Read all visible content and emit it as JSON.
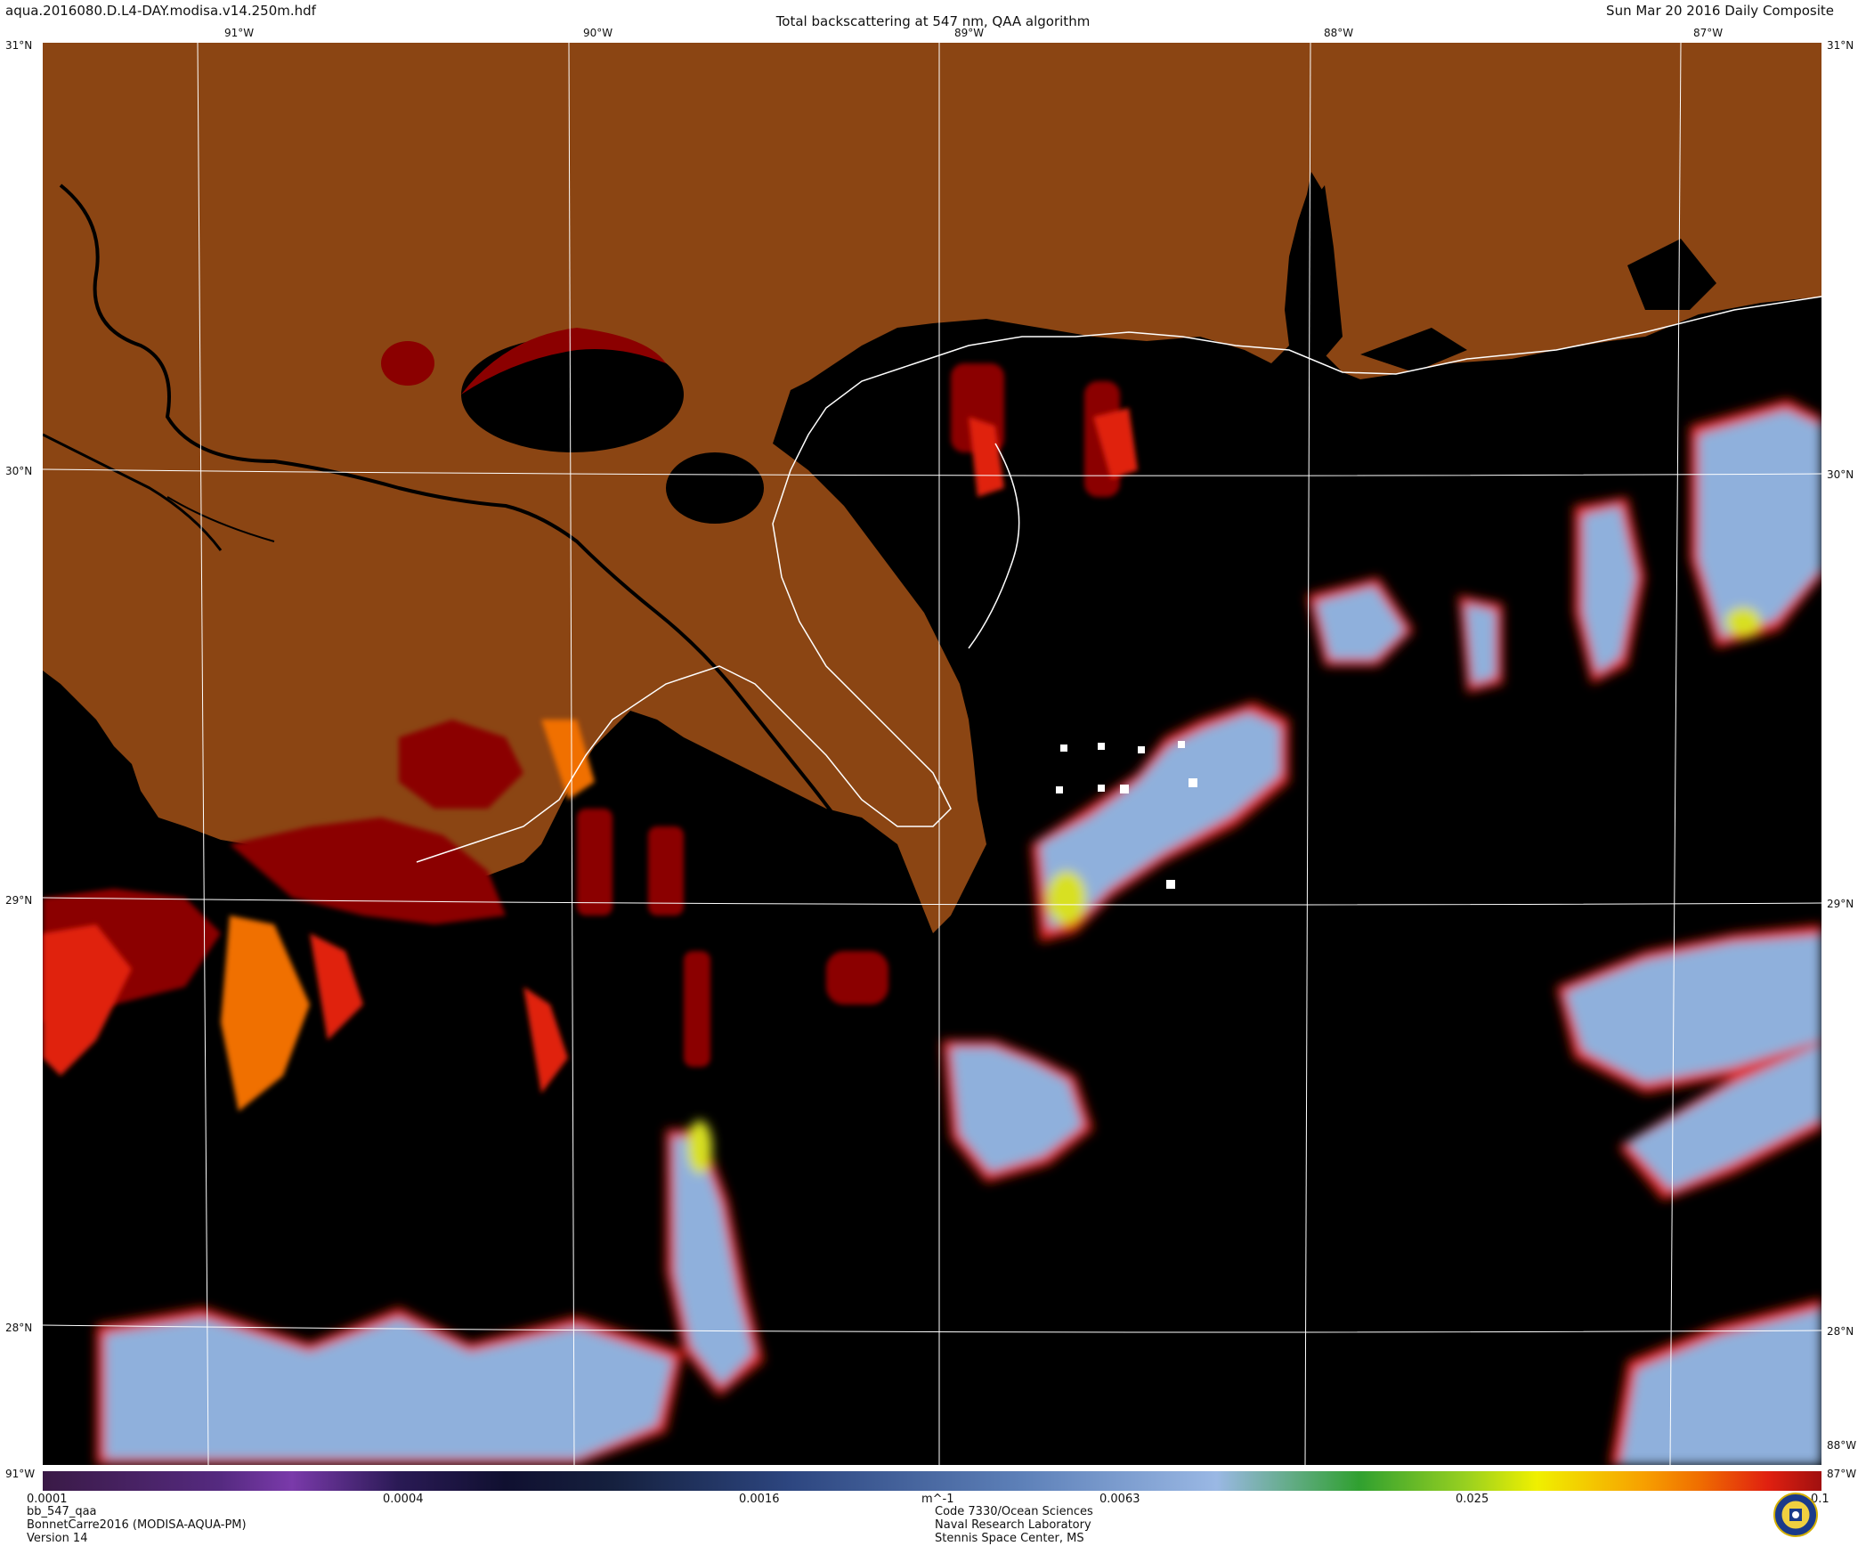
{
  "header": {
    "filename": "aqua.2016080.D.L4-DAY.modisa.v14.250m.hdf",
    "title": "Total backscattering at 547 nm, QAA algorithm",
    "composite": "Sun Mar 20 2016 Daily Composite"
  },
  "map": {
    "lon_labels": [
      "91°W",
      "90°W",
      "89°W",
      "88°W",
      "87°W"
    ],
    "lat_labels": [
      "30°N",
      "29°N",
      "28°N"
    ],
    "corner_labels": {
      "top_left": "31°N",
      "top_right": "31°N",
      "bottom_left": "91°W",
      "bottom_right": "87°W",
      "right_lower": "88°W"
    },
    "colors": {
      "land": "#8B4513",
      "water": "#000000",
      "coastline": "#ffffff",
      "grid": "#ffffff",
      "low_value": "#8fb0dc",
      "high_value": "#cc1010"
    }
  },
  "colorbar": {
    "ticks": [
      "0.0001",
      "0.0004",
      "0.0016",
      "m^-1",
      "0.0063",
      "0.025",
      "0.1"
    ],
    "scale": "log",
    "range": [
      0.0001,
      0.1
    ]
  },
  "footer": {
    "left": [
      "bb_547_qaa",
      "BonnetCarre2016 (MODISA-AQUA-PM)",
      "Version 14"
    ],
    "center": [
      "Code 7330/Ocean Sciences",
      "Naval Research Laboratory",
      "Stennis Space Center, MS"
    ],
    "logo_icon": "nrl-seal-icon"
  }
}
